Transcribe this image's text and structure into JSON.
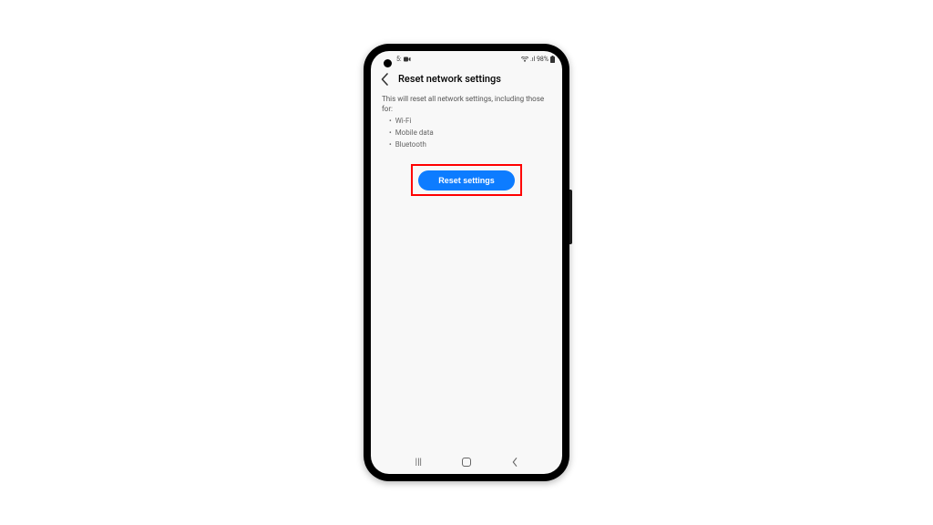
{
  "status_bar": {
    "time_left": "5:",
    "battery_text": ".ıl 98%"
  },
  "header": {
    "title": "Reset network settings"
  },
  "content": {
    "description": "This will reset all network settings, including those for:",
    "items": [
      "Wi-Fi",
      "Mobile data",
      "Bluetooth"
    ]
  },
  "button": {
    "label": "Reset settings"
  },
  "colors": {
    "accent": "#0d7cff",
    "highlight": "#ff0000"
  }
}
